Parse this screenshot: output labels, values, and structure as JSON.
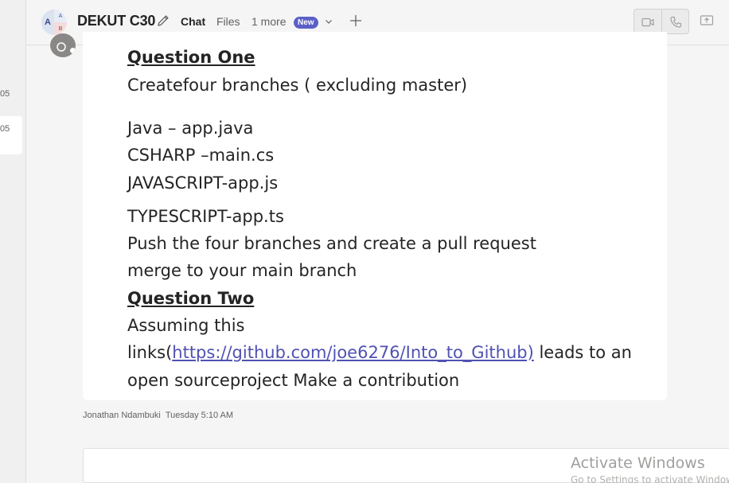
{
  "left_panel": {
    "items": [
      "05",
      "05"
    ]
  },
  "header": {
    "avatar_letters": [
      "A",
      "A",
      "B"
    ],
    "title": "DEKUT C30",
    "tabs": [
      {
        "label": "Chat",
        "active": true
      },
      {
        "label": "Files",
        "active": false
      },
      {
        "label": "1 more",
        "active": false
      }
    ],
    "new_badge": "New",
    "accent_color": "#5b5fc7"
  },
  "message": {
    "lines": {
      "q1_heading": "Question One ",
      "l1": "Createfour branches ( excluding master)",
      "l2": "Java – app.java",
      "l3": "CSHARP –main.cs",
      "l4": "JAVASCRIPT-app.js",
      "l5": "TYPESCRIPT-app.ts",
      "l6": "Push the four branches and create a pull request",
      "l7": "merge to your main branch",
      "q2_heading": "Question Two ",
      "l8": "Assuming this",
      "l9_prefix": "links(",
      "l9_link": "https://github.com/joe6276/Into_to_Github)",
      "l9_suffix": " leads to an",
      "l10": "open sourceproject Make a contribution"
    },
    "author": "Jonathan Ndambuki",
    "timestamp": "Tuesday 5:10 AM"
  },
  "watermark": {
    "title": "Activate Windows",
    "subtitle": "Go to Settings to activate Windows."
  }
}
